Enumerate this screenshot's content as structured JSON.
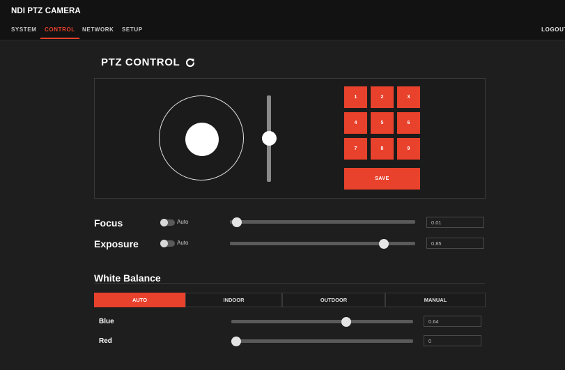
{
  "header": {
    "title": "NDI PTZ CAMERA",
    "logout_label": "LOGOUT"
  },
  "nav": {
    "items": [
      {
        "label": "SYSTEM",
        "active": false
      },
      {
        "label": "CONTROL",
        "active": true
      },
      {
        "label": "NETWORK",
        "active": false
      },
      {
        "label": "SETUP",
        "active": false
      }
    ]
  },
  "ptz": {
    "title": "PTZ CONTROL",
    "presets": [
      "1",
      "2",
      "3",
      "4",
      "5",
      "6",
      "7",
      "8",
      "9"
    ],
    "save_label": "SAVE"
  },
  "focus": {
    "label": "Focus",
    "auto_label": "Auto",
    "auto": false,
    "value": "0.01",
    "level": 0.01
  },
  "exposure": {
    "label": "Exposure",
    "auto_label": "Auto",
    "auto": false,
    "value": "0.85",
    "level": 0.85
  },
  "white_balance": {
    "title": "White Balance",
    "tabs": [
      "AUTO",
      "INDOOR",
      "OUTDOOR",
      "MANUAL"
    ],
    "active_tab": "AUTO",
    "blue": {
      "label": "Blue",
      "value": "0.64",
      "level": 0.64
    },
    "red": {
      "label": "Red",
      "value": "0",
      "level": 0
    }
  },
  "colors": {
    "accent": "#e8412c",
    "background": "#1e1e1e",
    "topbar": "#121212"
  },
  "icons": {
    "refresh": "refresh-icon"
  }
}
